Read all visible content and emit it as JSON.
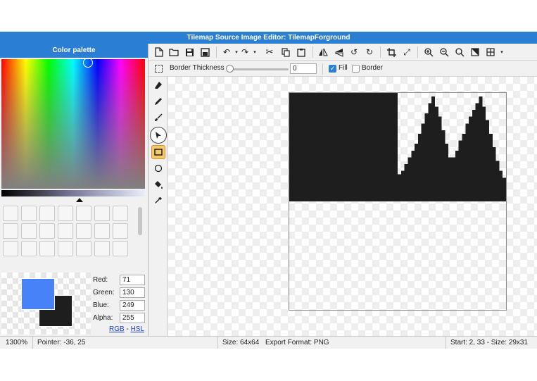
{
  "window": {
    "title": "Tilemap Source Image Editor: TilemapForground"
  },
  "palette": {
    "header": "Color palette",
    "swatch_count": 21,
    "primary_color": "#4782f9",
    "secondary_color": "#1e1e1e",
    "channels": [
      {
        "label": "Red:",
        "value": "71"
      },
      {
        "label": "Green:",
        "value": "130"
      },
      {
        "label": "Blue:",
        "value": "249"
      },
      {
        "label": "Alpha:",
        "value": "255"
      }
    ],
    "mode_links": {
      "rgb": "RGB",
      "sep": "-",
      "hsl": "HSL"
    }
  },
  "toolbar": {
    "icons": [
      "new-file-icon",
      "open-folder-icon",
      "save-icon",
      "save-as-icon",
      "undo-icon",
      "redo-icon",
      "cut-icon",
      "copy-icon",
      "paste-icon",
      "flip-horizontal-icon",
      "flip-vertical-icon",
      "rotate-left-icon",
      "rotate-right-icon",
      "crop-icon",
      "resize-icon",
      "zoom-in-icon",
      "zoom-out-icon",
      "zoom-fit-icon",
      "invert-icon",
      "grid-icon"
    ]
  },
  "options": {
    "border_thickness_label": "Border Thickness",
    "border_thickness_value": "0",
    "fill_label": "Fill",
    "fill_checked": true,
    "border_label": "Border",
    "border_checked": false
  },
  "tools": [
    "eraser-icon",
    "pencil-icon",
    "brush-icon",
    "select-icon",
    "rectangle-tool-icon",
    "ellipse-tool-icon",
    "fill-bucket-icon",
    "eyedropper-icon"
  ],
  "selected_tool": "rectangle-tool-icon",
  "status": {
    "zoom": "1300%",
    "pointer": "Pointer: -36, 25",
    "size": "Size: 64x64",
    "export": "Export Format: PNG",
    "selection": "Start: 2, 33 - Size: 29x31"
  }
}
